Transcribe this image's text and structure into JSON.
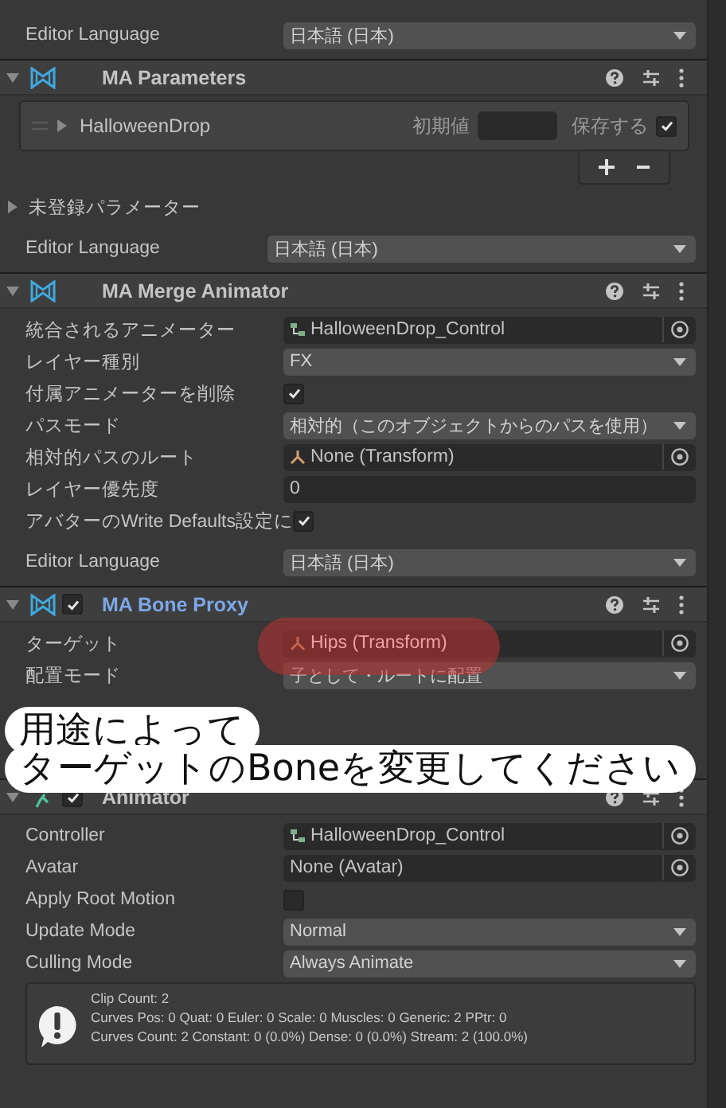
{
  "top_language": {
    "label": "Editor Language",
    "value": "日本語 (日本)"
  },
  "components": [
    {
      "kind": "ma",
      "title": "MA Parameters",
      "expanded": true,
      "parameters": [
        {
          "name": "HalloweenDrop",
          "expanded": false,
          "default_label": "初期値",
          "save_label": "保存する",
          "saved": true
        }
      ],
      "unregistered": {
        "label": "未登録パラメーター",
        "expanded": false
      },
      "language": {
        "label": "Editor Language",
        "value": "日本語 (日本)"
      }
    },
    {
      "kind": "ma",
      "title": "MA Merge Animator",
      "expanded": true,
      "rows": [
        {
          "kind": "controller-ref",
          "label": "統合されるアニメーター",
          "value": "HalloweenDrop_Control"
        },
        {
          "kind": "dropdown",
          "label": "レイヤー種別",
          "value": "FX"
        },
        {
          "kind": "checkbox",
          "label": "付属アニメーターを削除",
          "checked": true
        },
        {
          "kind": "dropdown",
          "label": "パスモード",
          "value": "相対的（このオブジェクトからのパスを使用）"
        },
        {
          "kind": "transform-ref",
          "label": "相対的パスのルート",
          "value": "None (Transform)"
        },
        {
          "kind": "number",
          "label": "レイヤー優先度",
          "value": "0"
        },
        {
          "kind": "checkbox",
          "label": "アバターのWrite Defaults設定に",
          "checked": true
        }
      ],
      "language": {
        "label": "Editor Language",
        "value": "日本語 (日本)"
      }
    },
    {
      "kind": "ma",
      "title": "MA Bone Proxy",
      "enabled": true,
      "modified": true,
      "expanded": true,
      "rows": [
        {
          "kind": "transform-ref",
          "label": "ターゲット",
          "value": "Hips (Transform)",
          "highlighted": true
        },
        {
          "kind": "dropdown",
          "label": "配置モード",
          "value": "子として・ルートに配置"
        }
      ]
    },
    {
      "kind": "animator",
      "title": "Animator",
      "enabled": true,
      "expanded": true,
      "rows": [
        {
          "kind": "controller-ref",
          "label": "Controller",
          "value": "HalloweenDrop_Control"
        },
        {
          "kind": "object",
          "label": "Avatar",
          "value": "None (Avatar)"
        },
        {
          "kind": "checkbox",
          "label": "Apply Root Motion",
          "checked": false
        },
        {
          "kind": "dropdown",
          "label": "Update Mode",
          "value": "Normal"
        },
        {
          "kind": "dropdown",
          "label": "Culling Mode",
          "value": "Always Animate"
        }
      ],
      "info": [
        "Clip Count: 2",
        "Curves Pos: 0 Quat: 0 Euler: 0 Scale: 0 Muscles: 0 Generic: 2 PPtr: 0",
        "Curves Count: 2 Constant: 0 (0.0%) Dense: 0 (0.0%) Stream: 2 (100.0%)"
      ]
    }
  ],
  "annotation": {
    "lines": [
      "用途によって",
      "ターゲットのBoneを変更してください"
    ]
  }
}
